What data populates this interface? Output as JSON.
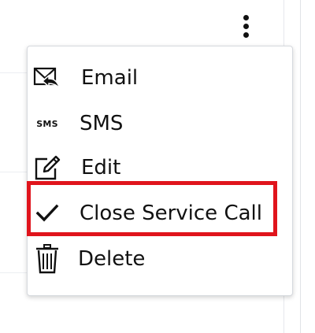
{
  "menu": {
    "items": [
      {
        "label": "Email",
        "icon": "email-reply-icon"
      },
      {
        "label": "SMS",
        "icon": "sms-icon",
        "icon_text": "SMS"
      },
      {
        "label": "Edit",
        "icon": "edit-pencil-icon"
      },
      {
        "label": "Close Service Call",
        "icon": "checkmark-icon"
      },
      {
        "label": "Delete",
        "icon": "trash-icon"
      }
    ]
  },
  "kebab": {
    "icon": "kebab-menu-icon"
  },
  "highlight": {
    "color": "#e0141c",
    "target": "Close Service Call"
  }
}
